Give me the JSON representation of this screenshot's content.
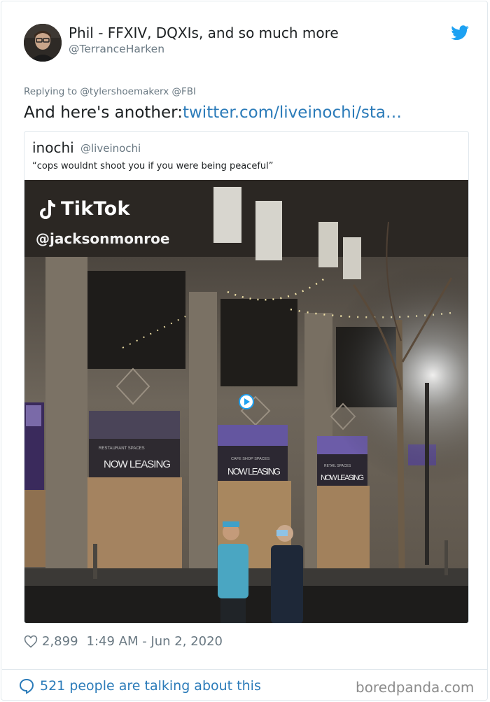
{
  "author": {
    "display_name": "Phil - FFXIV, DQXIs, and so much more",
    "handle": "@TerranceHarken"
  },
  "reply": {
    "prefix": "Replying to ",
    "mentions": "@tylershoemakerx @FBI"
  },
  "tweet": {
    "text": "And here's another:",
    "link": "twitter.com/liveinochi/sta…"
  },
  "quote": {
    "name": "inochi",
    "handle": "@liveinochi",
    "text": "“cops wouldnt shoot you if you were being peaceful”",
    "media": {
      "overlay_brand": "TikTok",
      "overlay_user": "@jacksonmonroe",
      "signs": [
        "NOW LEASING",
        "NOW LEASING",
        "NOW LEASING"
      ],
      "sign_small": [
        "RESTAURANT SPACES",
        "CAFE SHOP SPACES",
        "RETAIL SPACES"
      ]
    }
  },
  "meta": {
    "likes": "2,899",
    "timestamp": "1:49 AM - Jun 2, 2020"
  },
  "footer": {
    "talking": "521 people are talking about this",
    "watermark": "boredpanda.com"
  },
  "icons": {
    "brand": "twitter-bird-icon",
    "like": "heart-icon",
    "conversation": "speech-bubble-icon",
    "play": "play-icon"
  },
  "colors": {
    "link": "#2b7bb9",
    "twitter_blue": "#1da1f2",
    "muted": "#697882"
  }
}
